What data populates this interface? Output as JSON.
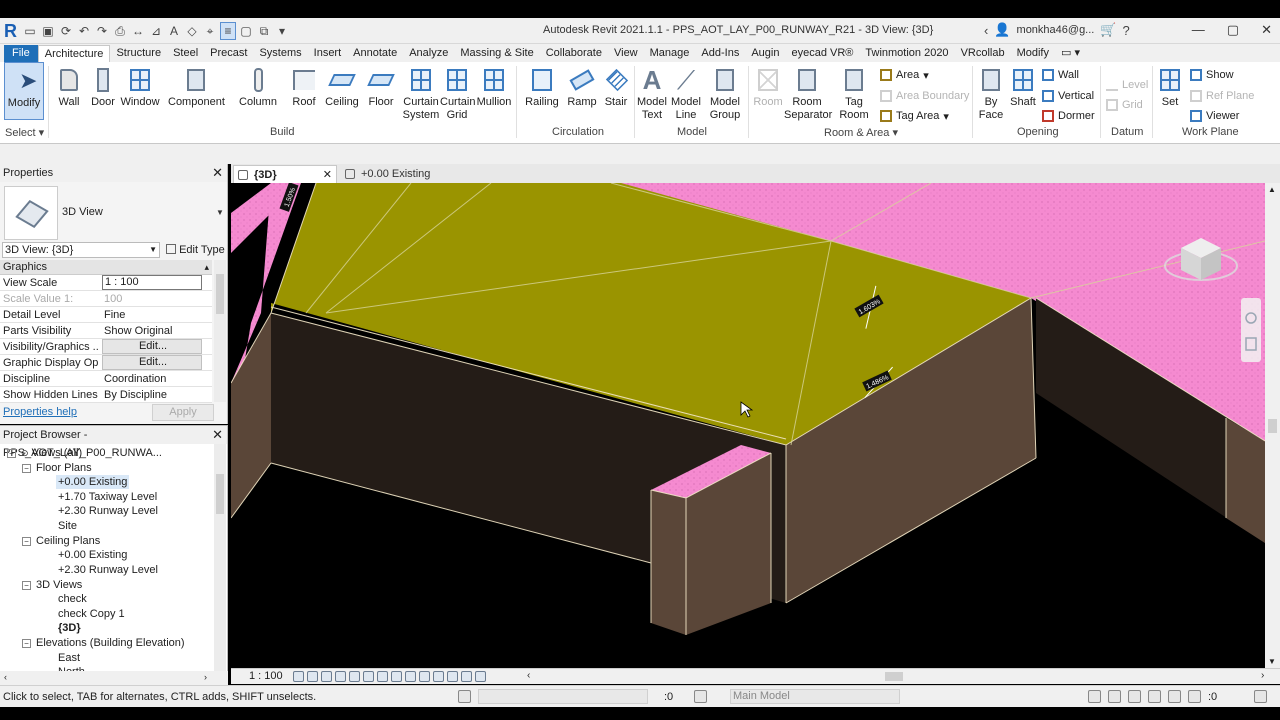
{
  "app": {
    "title": "Autodesk Revit 2021.1.1 - PPS_AOT_LAY_P00_RUNWAY_R21 - 3D View: {3D}",
    "user": "monkha46@g...",
    "logo": "R"
  },
  "tabs": [
    {
      "label": "File"
    },
    {
      "label": "Architecture"
    },
    {
      "label": "Structure"
    },
    {
      "label": "Steel"
    },
    {
      "label": "Precast"
    },
    {
      "label": "Systems"
    },
    {
      "label": "Insert"
    },
    {
      "label": "Annotate"
    },
    {
      "label": "Analyze"
    },
    {
      "label": "Massing & Site"
    },
    {
      "label": "Collaborate"
    },
    {
      "label": "View"
    },
    {
      "label": "Manage"
    },
    {
      "label": "Add-Ins"
    },
    {
      "label": "Augin"
    },
    {
      "label": "eyecad VR®"
    },
    {
      "label": "Twinmotion 2020"
    },
    {
      "label": "VRcollab"
    },
    {
      "label": "Modify"
    }
  ],
  "ribbon": {
    "select_label": "Select",
    "panels": {
      "build": "Build",
      "circulation": "Circulation",
      "model": "Model",
      "room_area": "Room & Area",
      "opening": "Opening",
      "datum": "Datum",
      "work_plane": "Work Plane"
    },
    "buttons": {
      "modify": "Modify",
      "wall": "Wall",
      "door": "Door",
      "window": "Window",
      "component": "Component",
      "column": "Column",
      "roof": "Roof",
      "ceiling": "Ceiling",
      "floor": "Floor",
      "curtain_system": "Curtain\nSystem",
      "curtain_grid": "Curtain\nGrid",
      "mullion": "Mullion",
      "railing": "Railing",
      "ramp": "Ramp",
      "stair": "Stair",
      "model_text": "Model\nText",
      "model_line": "Model\nLine",
      "model_group": "Model\nGroup",
      "room": "Room",
      "room_separator": "Room\nSeparator",
      "tag_room": "Tag\nRoom",
      "area": "Area",
      "area_boundary": "Area  Boundary",
      "tag_area": "Tag  Area",
      "by_face": "By\nFace",
      "shaft": "Shaft",
      "wall_op": "Wall",
      "vertical": "Vertical",
      "dormer": "Dormer",
      "level": "Level",
      "grid": "Grid",
      "set": "Set",
      "show": "Show",
      "ref_plane": "Ref  Plane",
      "viewer": "Viewer"
    }
  },
  "properties": {
    "title": "Properties",
    "type_name": "3D View",
    "instance_selector": "3D View: {3D}",
    "edit_type": "Edit Type",
    "group": "Graphics",
    "rows": [
      {
        "k": "View Scale",
        "v": "1 : 100"
      },
      {
        "k": "Scale Value    1:",
        "v": "100"
      },
      {
        "k": "Detail Level",
        "v": "Fine"
      },
      {
        "k": "Parts Visibility",
        "v": "Show Original"
      },
      {
        "k": "Visibility/Graphics ...",
        "v": "Edit..."
      },
      {
        "k": "Graphic Display Op...",
        "v": "Edit..."
      },
      {
        "k": "Discipline",
        "v": "Coordination"
      },
      {
        "k": "Show Hidden Lines",
        "v": "By Discipline"
      }
    ],
    "help": "Properties help",
    "apply": "Apply"
  },
  "browser": {
    "title": "Project Browser - PPS_AOT_LAY_P00_RUNWA...",
    "nodes": [
      {
        "label": "Views (all)"
      },
      {
        "label": "Floor Plans"
      },
      {
        "label": "+0.00 Existing"
      },
      {
        "label": "+1.70 Taxiway Level"
      },
      {
        "label": "+2.30 Runway Level"
      },
      {
        "label": "Site"
      },
      {
        "label": "Ceiling Plans"
      },
      {
        "label": "+0.00 Existing"
      },
      {
        "label": "+2.30 Runway Level"
      },
      {
        "label": "3D Views"
      },
      {
        "label": "check"
      },
      {
        "label": "check Copy 1"
      },
      {
        "label": "{3D}"
      },
      {
        "label": "Elevations (Building Elevation)"
      },
      {
        "label": "East"
      },
      {
        "label": "North"
      }
    ]
  },
  "view_tabs": {
    "active": "{3D}",
    "inactive": "+0.00 Existing"
  },
  "viewport": {
    "slope_labels": [
      "1.50%",
      "1.603%",
      "1.486%"
    ],
    "colors": {
      "pink": "#f58ad0",
      "olive": "#9a9400",
      "side": "#5a4638",
      "dark": "#241c17"
    }
  },
  "viewbar": {
    "scale": "1 : 100"
  },
  "status": {
    "message": "Click to select, TAB for alternates, CTRL adds, SHIFT unselects.",
    "zero": ":0",
    "model": "Main Model",
    "filters": ":0"
  }
}
